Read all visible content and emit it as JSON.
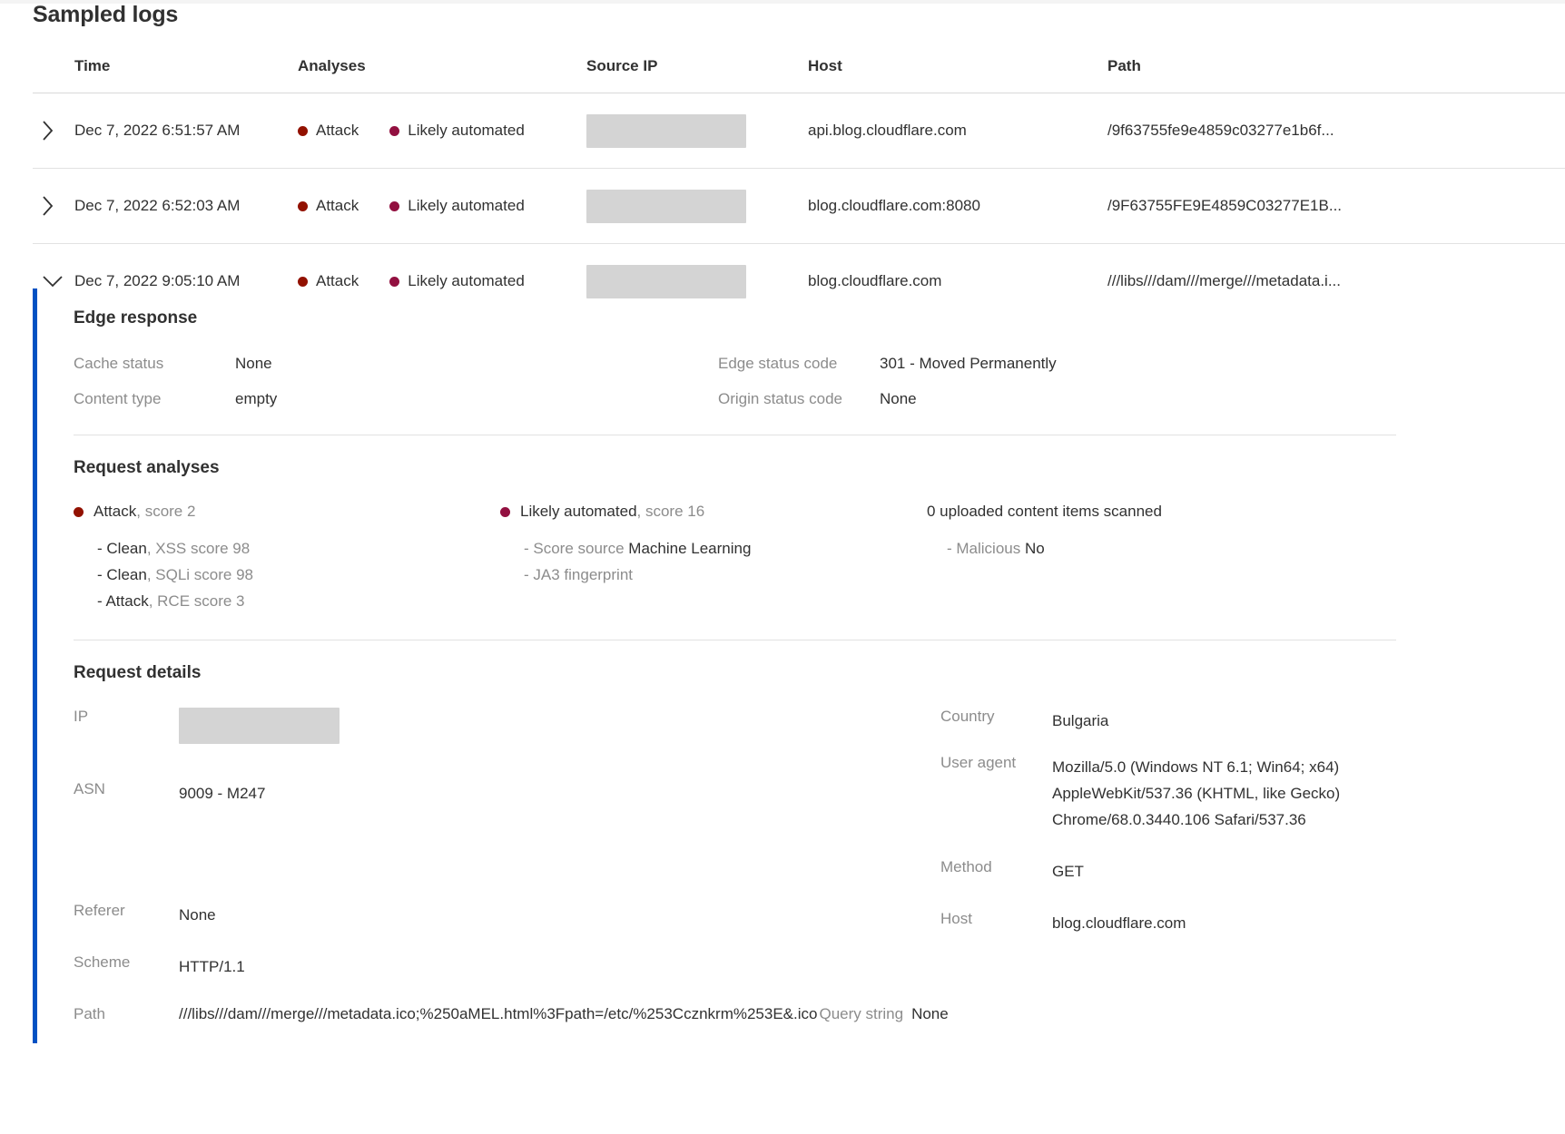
{
  "header": {
    "title": "Sampled logs"
  },
  "table": {
    "columns": [
      "Time",
      "Analyses",
      "Source IP",
      "Host",
      "Path"
    ],
    "rows": [
      {
        "expanded": false,
        "caret": "chevron-right-icon",
        "time": "Dec 7, 2022 6:51:57 AM",
        "analyses": [
          {
            "label": "Attack",
            "color": "#921100"
          },
          {
            "label": "Likely automated",
            "color": "#921040"
          }
        ],
        "source_ip": "",
        "host": "api.blog.cloudflare.com",
        "path": "/9f63755fe9e4859c03277e1b6f..."
      },
      {
        "expanded": false,
        "caret": "chevron-right-icon",
        "time": "Dec 7, 2022 6:52:03 AM",
        "analyses": [
          {
            "label": "Attack",
            "color": "#921100"
          },
          {
            "label": "Likely automated",
            "color": "#921040"
          }
        ],
        "source_ip": "",
        "host": "blog.cloudflare.com:8080",
        "path": "/9F63755FE9E4859C03277E1B..."
      },
      {
        "expanded": true,
        "caret": "chevron-down-icon",
        "time": "Dec 7, 2022 9:05:10 AM",
        "analyses": [
          {
            "label": "Attack",
            "color": "#921100"
          },
          {
            "label": "Likely automated",
            "color": "#921040"
          }
        ],
        "source_ip": "",
        "host": "blog.cloudflare.com",
        "path": "///libs///dam///merge///metadata.i..."
      }
    ]
  },
  "detail": {
    "edge_response": {
      "title": "Edge response",
      "left": [
        {
          "key": "Cache status",
          "value": "None"
        },
        {
          "key": "Content type",
          "value": "empty"
        }
      ],
      "right": [
        {
          "key": "Edge status code",
          "value": "301 - Moved Permanently"
        },
        {
          "key": "Origin status code",
          "value": "None"
        }
      ]
    },
    "request_analyses": {
      "title": "Request analyses",
      "col1": {
        "dot_color": "#921100",
        "label": "Attack",
        "score": ", score 2",
        "items": [
          {
            "dash": "- ",
            "strong": "Clean",
            "muted": ", XSS score 98"
          },
          {
            "dash": "- ",
            "strong": "Clean",
            "muted": ", SQLi score 98"
          },
          {
            "dash": "- ",
            "strong": "Attack",
            "muted": ", RCE score 3"
          }
        ]
      },
      "col2": {
        "dot_color": "#921040",
        "label": "Likely automated",
        "score": ", score 16",
        "items": [
          {
            "dash": "- ",
            "muted": "Score source",
            "strong": "  Machine Learning"
          },
          {
            "dash": "- ",
            "muted": "JA3 fingerprint",
            "strong": ""
          }
        ]
      },
      "col3": {
        "heading": "0 uploaded content items scanned",
        "items": [
          {
            "dash": "- ",
            "muted": "Malicious",
            "strong": "  No"
          }
        ]
      }
    },
    "request_details": {
      "title": "Request details",
      "left": [
        {
          "key": "IP",
          "value": "",
          "redacted": true
        },
        {
          "key": "ASN",
          "value": "9009 - M247"
        },
        {
          "key": "Referer",
          "value": "None"
        },
        {
          "key": "Scheme",
          "value": "HTTP/1.1"
        }
      ],
      "right": [
        {
          "key": "Country",
          "value": "Bulgaria"
        },
        {
          "key": "User agent",
          "value": "Mozilla/5.0 (Windows NT 6.1; Win64; x64) AppleWebKit/537.36 (KHTML, like Gecko) Chrome/68.0.3440.106 Safari/537.36"
        },
        {
          "key": "Method",
          "value": "GET"
        },
        {
          "key": "Host",
          "value": "blog.cloudflare.com"
        }
      ],
      "path_row": {
        "key": "Path",
        "value": "///libs///dam///merge///metadata.ico;%250aMEL.html%3Fpath=/etc/%253Ccznkrm%253E&.ico",
        "query_key": "Query string",
        "query_value": "None"
      }
    }
  },
  "colors": {
    "accent_blue": "#0051c3",
    "attack_red": "#921100",
    "automated_red": "#921040",
    "muted_text": "#8c8c8c",
    "body_text": "#313131",
    "redaction": "#d4d4d4"
  }
}
